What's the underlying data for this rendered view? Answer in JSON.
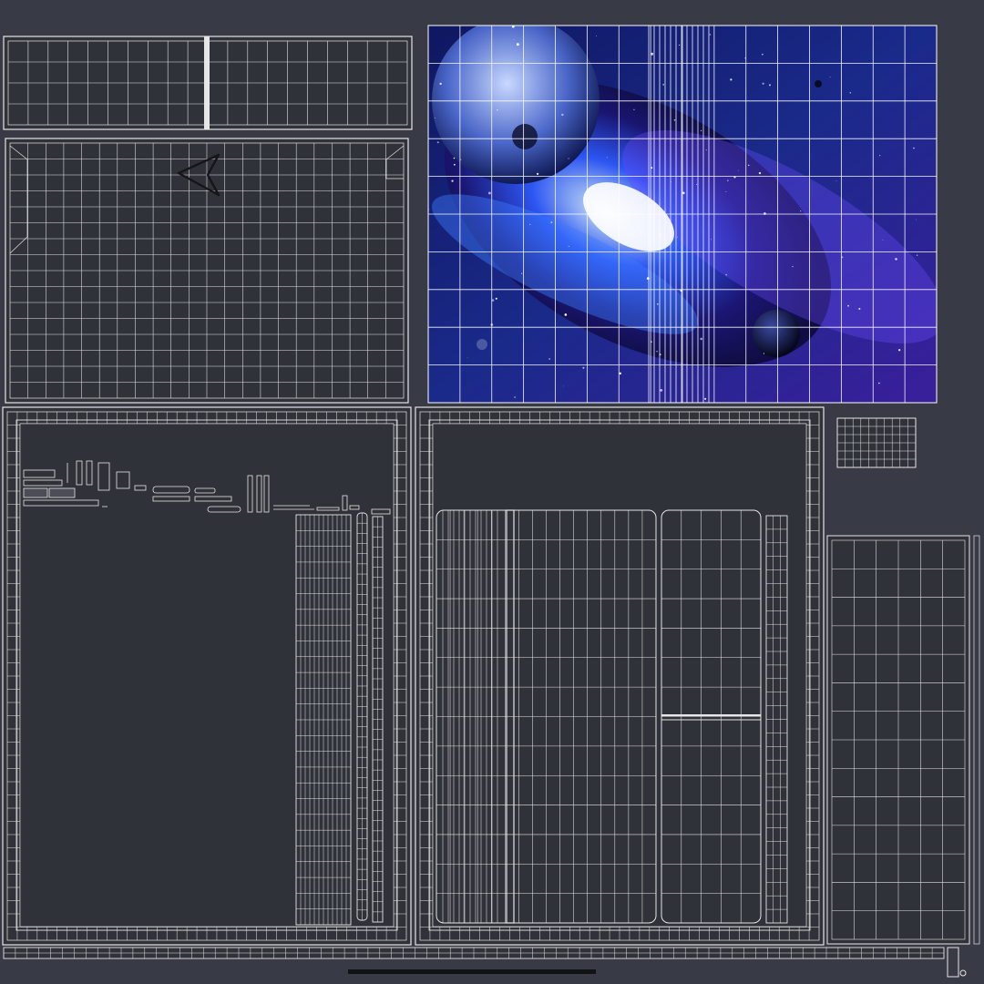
{
  "colors": {
    "background": "#383b45",
    "panel_fill": "#2f3238",
    "wire": "#e6e6e6",
    "wire_dim": "#b9bcc2",
    "space_deep": "#120a55",
    "space_glow": "#6a5cff",
    "nebula_core": "#ffffff",
    "nebula_blue": "#2f6bff"
  },
  "icons": {
    "navigation": "navigation-arrow-icon"
  }
}
